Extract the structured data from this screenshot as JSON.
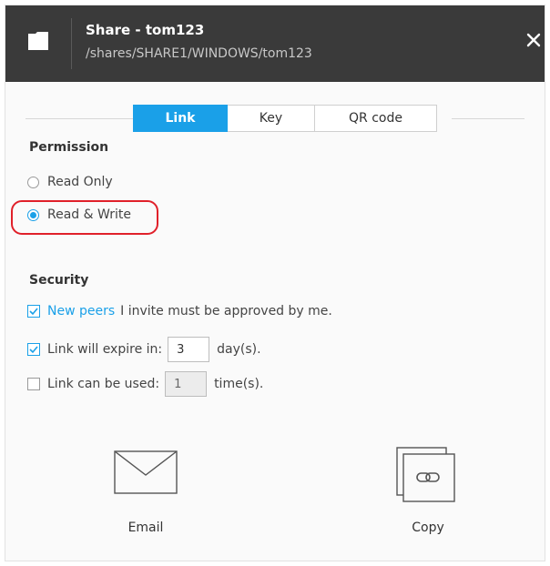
{
  "header": {
    "title": "Share - tom123",
    "path": "/shares/SHARE1/WINDOWS/tom123",
    "folder_icon": "folder-icon",
    "close_icon": "close-icon"
  },
  "tabs": [
    {
      "label": "Link",
      "active": true
    },
    {
      "label": "Key",
      "active": false
    },
    {
      "label": "QR code",
      "active": false
    }
  ],
  "permission": {
    "title": "Permission",
    "options": [
      {
        "label": "Read Only",
        "selected": false
      },
      {
        "label": "Read & Write",
        "selected": true
      }
    ]
  },
  "security": {
    "title": "Security",
    "new_peers": {
      "checked": true,
      "link_text": "New peers",
      "text": "I invite must be approved by me."
    },
    "expire": {
      "checked": true,
      "label": "Link will expire in:",
      "value": "3",
      "unit": "day(s)."
    },
    "usage": {
      "checked": false,
      "label": "Link can be used:",
      "value": "1",
      "unit": "time(s)."
    }
  },
  "actions": {
    "email": {
      "label": "Email",
      "icon": "envelope-icon"
    },
    "copy": {
      "label": "Copy",
      "icon": "copy-link-icon"
    }
  },
  "colors": {
    "accent": "#1aa0e8",
    "header_bg": "#3a3a3a",
    "highlight": "#e0202a"
  }
}
